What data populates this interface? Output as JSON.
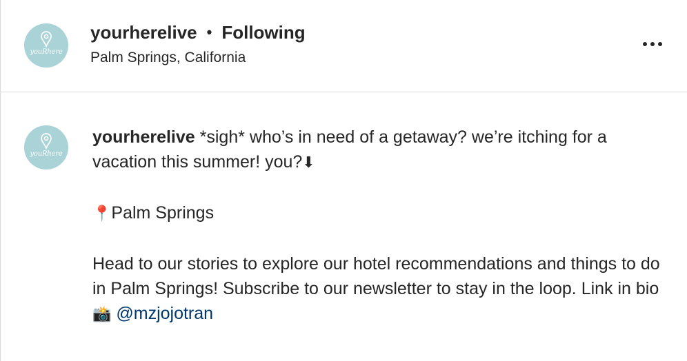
{
  "header": {
    "username": "yourherelive",
    "separator": "•",
    "follow_status": "Following",
    "location": "Palm Springs, California",
    "avatar_brand": "youRhere",
    "more_icon": "more-horizontal-icon"
  },
  "post": {
    "username": "yourherelive",
    "avatar_brand": "youRhere",
    "line1": "*sigh* who’s in need of a getaway? we’re itching for a vacation this summer! you?",
    "arrow_emoji": "⬇",
    "pin_emoji": "📍",
    "location_line": "Palm Springs",
    "body": "Head to our stories to explore our hotel recommendations and things to do in Palm Springs! Subscribe to our newsletter to stay in the loop. Link in bio",
    "camera_emoji": "📸",
    "mention": "@mzjojotran"
  },
  "colors": {
    "avatar_bg": "#a9d3d6",
    "text": "#262626",
    "link": "#00376b",
    "divider": "#dbdbdb"
  }
}
